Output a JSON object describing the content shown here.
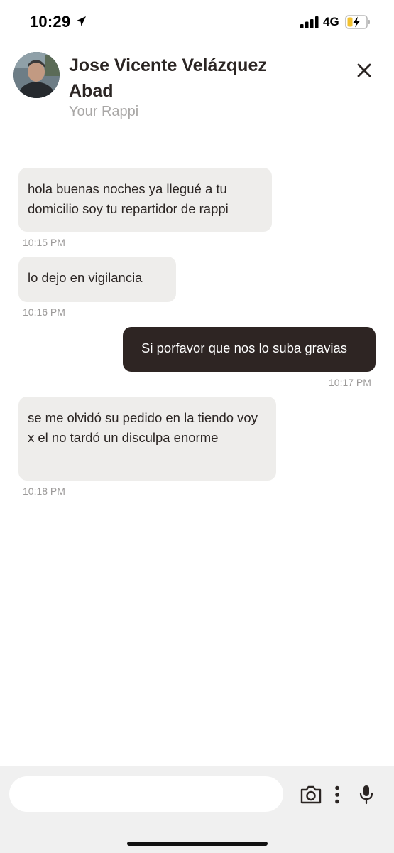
{
  "status_bar": {
    "time": "10:29",
    "network": "4G"
  },
  "header": {
    "contact_name": "Jose Vicente Velázquez Abad",
    "subtitle": "Your Rappi",
    "close_icon": "close-icon"
  },
  "messages": [
    {
      "direction": "incoming",
      "text": "hola buenas noches ya llegué a tu domicilio soy tu repartidor de rappi",
      "time": "10:15 PM"
    },
    {
      "direction": "incoming",
      "text": "lo dejo en vigilancia",
      "time": "10:16 PM"
    },
    {
      "direction": "outgoing",
      "text": "Si porfavor que nos lo suba gravias",
      "time": "10:17 PM"
    },
    {
      "direction": "incoming",
      "text": "se me olvidó su pedido en la tiendo voy x el no tardó un disculpa enorme",
      "time": "10:18 PM"
    }
  ],
  "composer": {
    "input_value": "",
    "placeholder": "",
    "icons": [
      "camera-icon",
      "more-vertical-icon",
      "microphone-icon"
    ]
  },
  "colors": {
    "incoming_bubble": "#eeedeb",
    "outgoing_bubble": "#2e2523",
    "text_dark": "#2b2523",
    "muted": "#a9a7a6"
  }
}
